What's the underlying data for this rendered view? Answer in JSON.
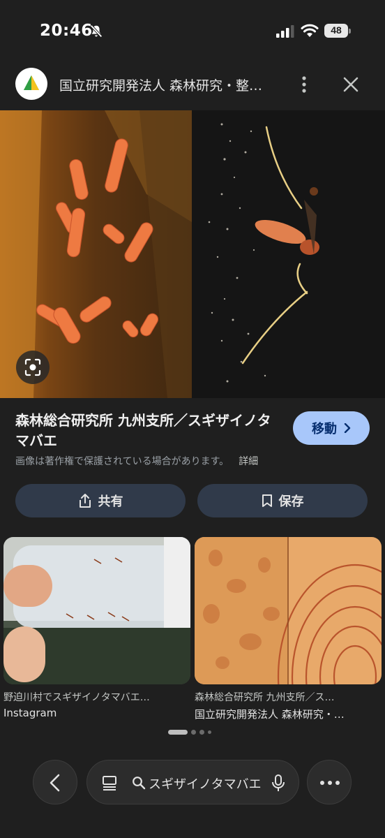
{
  "status_bar": {
    "time": "20:46",
    "battery": "48",
    "icons": [
      "bell-off-icon",
      "signal-icon",
      "wifi-icon",
      "battery-icon"
    ]
  },
  "header": {
    "site_title": "国立研究開発法人 森林研究・整…",
    "logo_icon": "forest-logo-icon",
    "menu_icon": "more-vert-icon",
    "close_icon": "close-icon"
  },
  "result": {
    "title": "森林総合研究所 九州支所／スギザイノタマバエ",
    "visit_label": "移動",
    "copyright": "画像は著作権で保護されている場合があります。",
    "detail_label": "詳細",
    "share_label": "共有",
    "save_label": "保存"
  },
  "related": [
    {
      "caption": "野迫川村でスギザイノタマバエ…",
      "source": "Instagram"
    },
    {
      "caption": "森林総合研究所 九州支所／ス…",
      "source": "国立研究開発法人 森林研究・…"
    }
  ],
  "search": {
    "query": "スギザイノタマバエ"
  },
  "colors": {
    "background": "#1f1f1f",
    "accent": "#a8c7fa",
    "button": "#303a4a"
  }
}
